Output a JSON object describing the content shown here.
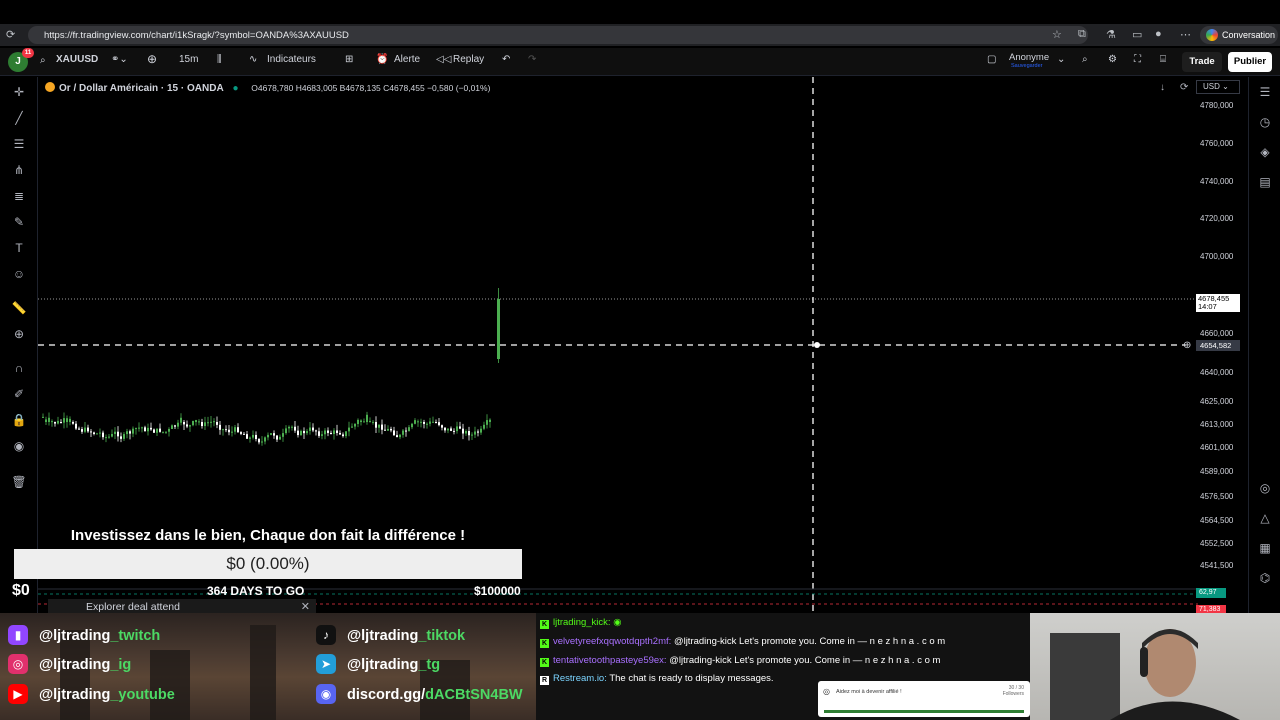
{
  "browser": {
    "url": "https://fr.tradingview.com/chart/i1kSragk/?symbol=OANDA%3AXAUUSD",
    "conversation_label": "Conversation"
  },
  "toolbar": {
    "avatar_letter": "J",
    "avatar_badge": "11",
    "symbol": "XAUUSD",
    "interval": "15m",
    "indicators": "Indicateurs",
    "alert": "Alerte",
    "replay": "Replay",
    "user_name": "Anonyme",
    "user_sub": "Sauvegarder",
    "trade": "Trade",
    "publish": "Publier"
  },
  "legend": {
    "title": "Or / Dollar Américain · 15 · OANDA",
    "ohlc": "O4678,780 H4683,005 B4678,135 C4678,455 −0,580 (−0,01%)"
  },
  "price_axis": {
    "currency": "USD",
    "ticks": [
      "4780,000",
      "4760,000",
      "4740,000",
      "4720,000",
      "4700,000",
      "4660,000",
      "4640,000",
      "4625,000",
      "4613,000",
      "4601,000",
      "4589,000",
      "4576,500",
      "4564,500",
      "4552,500",
      "4541,500"
    ],
    "last_price": "4678,455",
    "last_time": "14:07",
    "crosshair_price": "4654,582",
    "green_tag": "62,97",
    "red_tag": "71,383"
  },
  "chart_data": {
    "type": "candlestick",
    "symbol": "XAUUSD",
    "interval": "15",
    "last_close": 4678.455,
    "crosshair_price": 4654.582
  },
  "donation": {
    "title": "Investissez dans le bien, Chaque don fait la différence !",
    "amount": "$0 (0.00%)",
    "start": "$0",
    "days_left": "364 DAYS TO GO",
    "goal": "$100000"
  },
  "explore_banner": "Explorer deal attend",
  "socials": [
    {
      "icon": "twitch-icon",
      "prefix": "@ljtrading",
      "suffix": "_twitch",
      "color": "#9146ff",
      "glyph": "▮"
    },
    {
      "icon": "instagram-icon",
      "prefix": "@ljtrading",
      "suffix": "_ig",
      "color": "#e1306c",
      "glyph": "◎"
    },
    {
      "icon": "youtube-icon",
      "prefix": "@ljtrading",
      "suffix": "_youtube",
      "color": "#ff0000",
      "glyph": "▶"
    },
    {
      "icon": "tiktok-icon",
      "prefix": "@ljtrading",
      "suffix": "_tiktok",
      "color": "#111111",
      "glyph": "♪"
    },
    {
      "icon": "telegram-icon",
      "prefix": "@ljtrading",
      "suffix": "_tg",
      "color": "#229ed9",
      "glyph": "➤"
    },
    {
      "icon": "discord-icon",
      "prefix": "discord.gg/",
      "suffix": "dACBtSN4BW",
      "color": "#5865f2",
      "glyph": "◉"
    }
  ],
  "chat": [
    {
      "user": "ljtrading_kick:",
      "message": ""
    },
    {
      "user": "velvetyreefxqqwotdqpth2mf:",
      "message": "@ljtrading-kick Let's promote you. Come in — n e z h n a . c o m"
    },
    {
      "user": "tentativetoothpasteye59ex:",
      "message": "@ljtrading-kick Let's promote you. Come in — n e z h n a . c o m"
    },
    {
      "user": "Restream.io:",
      "message": "The chat is ready to display messages."
    }
  ],
  "affiliate": {
    "text": "Aidez moi à devenir affilié !",
    "count": "30 / 30",
    "count_label": "Followers"
  }
}
